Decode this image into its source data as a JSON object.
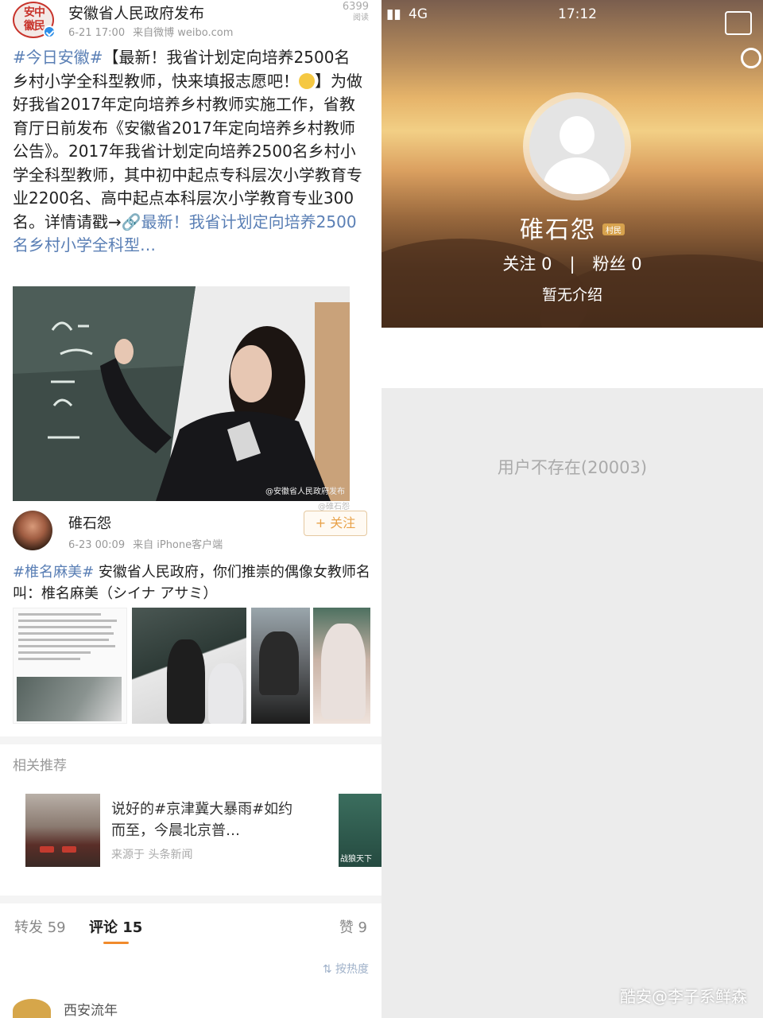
{
  "left": {
    "post": {
      "author": "安徽省人民政府发布",
      "avatar_seal": "安中徽民",
      "date": "6-21 17:00",
      "source": "来自微博 weibo.com",
      "views": "6399",
      "views_unit": "阅读",
      "text_tag": "#今日安徽#",
      "text_part1": "【最新！我省计划定向培养2500名乡村小学全科型教师，快来填报志愿吧！",
      "text_part2": "】为做好我省2017年定向培养乡村教师实施工作，省教育厅日前发布《安徽省2017年定向培养乡村教师公告》。2017年我省计划定向培养2500名乡村小学全科型教师，其中初中起点专科层次小学教育专业2200名、高中起点本科层次小学教育专业300名。详情请戳→",
      "text_link": "🔗最新！我省计划定向培养2500名乡村小学全科型…",
      "photo_watermark": "@安徽省人民政府发布",
      "photo_watermark2": "@碓石怨"
    },
    "comment": {
      "author": "碓石怨",
      "date": "6-23 00:09",
      "source": "来自 iPhone客户端",
      "follow_label": "+ 关注",
      "tag": "#椎名麻美#",
      "text": " 安徽省人民政府，你们推崇的偶像女教师名叫：椎名麻美（シイナ アサミ）"
    },
    "related": {
      "title": "相关推荐",
      "card_text": "说好的#京津冀大暴雨#如约而至，今晨北京普…",
      "card_source": "来源于 头条新闻",
      "card2_text": "战狼天下"
    },
    "tabs": [
      {
        "label": "转发 59"
      },
      {
        "label": "评论 15"
      },
      {
        "label": "赞 9"
      }
    ],
    "sort_label": "按热度",
    "bottom_name": "西安流年"
  },
  "right": {
    "status": {
      "carrier": "4G",
      "time": "17:12"
    },
    "profile": {
      "name": "碓石怨",
      "badge": "村民",
      "following_label": "关注",
      "following": "0",
      "followers_label": "粉丝",
      "followers": "0",
      "intro": "暂无介绍"
    },
    "error": "用户不存在(20003)",
    "watermark": "酷安@李子系鲜森"
  },
  "colors": {
    "link": "#5a7fb5",
    "accent": "#f18b2c",
    "grey_bg": "#ececec"
  }
}
